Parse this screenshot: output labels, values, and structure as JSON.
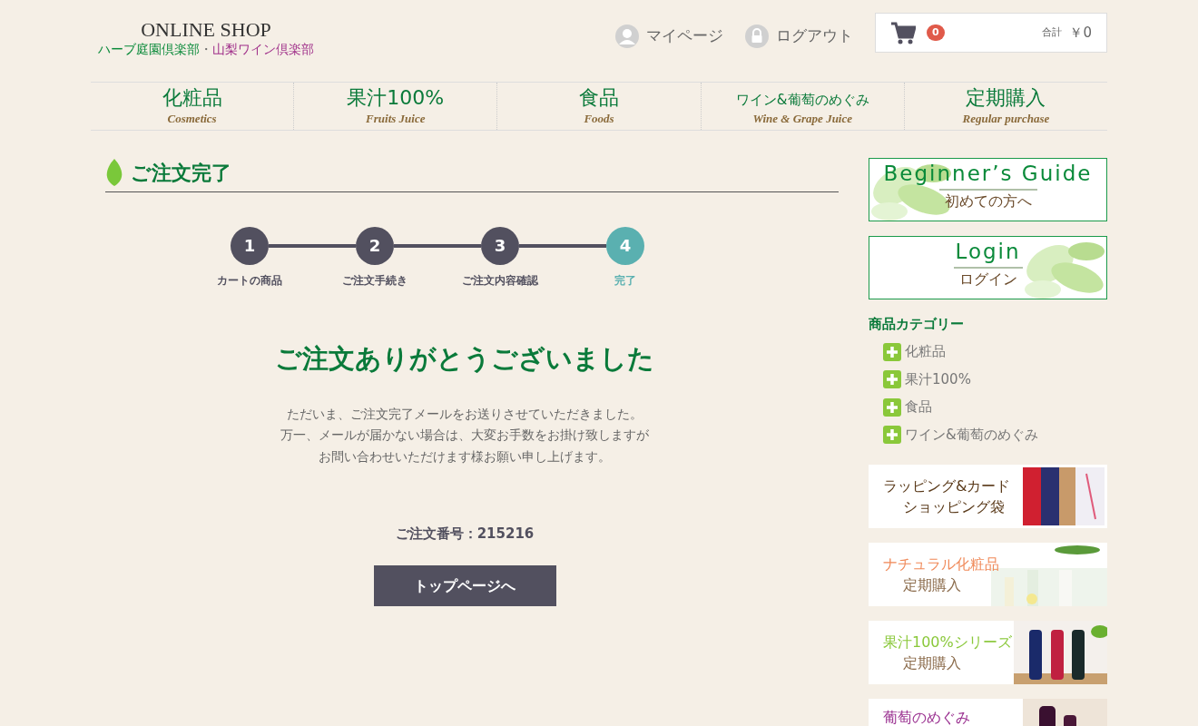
{
  "header": {
    "shop_name": "ONLINE SHOP",
    "clubs": [
      {
        "label": "ハーブ庭園倶楽部",
        "color": "#0a8a3a"
      },
      {
        "label": "山梨ワイン倶楽部",
        "color": "#a0308a"
      }
    ],
    "separator": "・"
  },
  "top_links": [
    {
      "kind": "user",
      "label": "マイページ"
    },
    {
      "kind": "lock",
      "label": "ログアウト"
    }
  ],
  "cart": {
    "count": "0",
    "total_label": "合計",
    "total": "￥0"
  },
  "nav": [
    {
      "label": "化粧品",
      "sublabel": "Cosmetics"
    },
    {
      "label": "果汁100%",
      "sublabel": "Fruits Juice"
    },
    {
      "label": "食品",
      "sublabel": "Foods"
    },
    {
      "label": "ワイン&葡萄のめぐみ",
      "sublabel": "Wine & Grape Juice",
      "small": true
    },
    {
      "label": "定期購入",
      "sublabel": "Regular purchase"
    }
  ],
  "page_title": "ご注文完了",
  "steps": [
    {
      "number": "1",
      "label": "カートの商品",
      "selected": false
    },
    {
      "number": "2",
      "label": "ご注文手続き",
      "selected": false
    },
    {
      "number": "3",
      "label": "ご注文内容確認",
      "selected": false
    },
    {
      "number": "4",
      "label": "完了",
      "selected": true
    }
  ],
  "thanks": "ご注文ありがとうございました",
  "message": [
    "ただいま、ご注文完了メールをお送りさせていただきました。",
    "万一、メールが届かない場合は、大変お手数をお掛け致しますが",
    "お問い合わせいただけます様お願い申し上げます。"
  ],
  "order_number": "ご注文番号：215216",
  "top_button": "トップページへ",
  "sidebar": {
    "guides": [
      {
        "title": "Beginner’s Guide",
        "subtitle": "初めての方へ"
      },
      {
        "title": "Login",
        "subtitle": "ログイン"
      }
    ],
    "category_heading": "商品カテゴリー",
    "categories": [
      "化粧品",
      "果汁100%",
      "食品",
      "ワイン&葡萄のめぐみ"
    ],
    "banners": [
      {
        "kind": "wrapping",
        "lines": [
          {
            "text": "ラッピング&カード",
            "color": "#5a3a1a"
          },
          {
            "text": "ショッピング袋",
            "color": "#5a3a1a"
          }
        ]
      },
      {
        "kind": "cosmetics",
        "lines": [
          {
            "text": "ナチュラル化粧品",
            "color": "#f08a5a"
          },
          {
            "text": "定期購入",
            "color": "#8a6a4a"
          }
        ]
      },
      {
        "kind": "juice",
        "lines": [
          {
            "text": "果汁100%シリーズ",
            "color": "#8ac83a"
          },
          {
            "text": "定期購入",
            "color": "#8a6a4a"
          }
        ]
      },
      {
        "kind": "grape",
        "lines": [
          {
            "text": "葡萄のめぐみ",
            "color": "#9a3090"
          }
        ]
      }
    ]
  }
}
